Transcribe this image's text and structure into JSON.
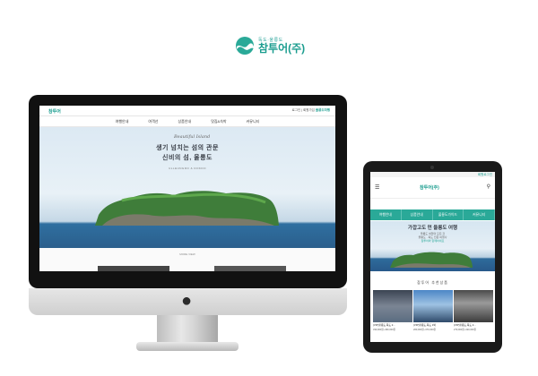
{
  "brand": {
    "sub": "독도·울릉도",
    "name": "참투어(주)"
  },
  "desktop": {
    "logo": "참투어",
    "util_links": "로그인 | 회원가입",
    "util_highlight": "울릉도여행",
    "nav": [
      "여행안내",
      "여객선",
      "상품안내",
      "맛집&숙박",
      "커뮤니티"
    ],
    "script_title": "Beautiful Island",
    "headline_1": "생기 넘치는 섬의 관문",
    "headline_2": "신비의 섬, 울릉도",
    "subline": "ULLEUNGDO & DOKDO",
    "more_label": "MORE VIEW"
  },
  "tablet": {
    "member_link": "회원로그인",
    "menu_icon": "hamburger-icon",
    "logo": "참투어(주)",
    "search_icon": "search-icon",
    "tabs": [
      "여행안내",
      "상품안내",
      "울릉도가이드",
      "커뮤니티"
    ],
    "headline": "가깝고도 먼 울릉도 여행",
    "sub_1": "울릉도 여행의 모든 것",
    "sub_2": "울릉도 · 독도 전문 여행사",
    "sub_3": "참투어와 함께하세요",
    "section_title": "참투어 추천상품",
    "products": [
      {
        "caption": "(VIP)울릉도,독도 2...",
        "price": "330,000원~360,000원"
      },
      {
        "caption": "(VIP)울릉도,독도 1박",
        "price": "260,000원~370,000원"
      },
      {
        "caption": "(VIP)울릉도,독도 2...",
        "price": "270,000원~320,000원"
      }
    ]
  },
  "colors": {
    "brand_teal": "#1b9d8f",
    "tab_teal": "#2aa998",
    "sea_blue": "#2b5f8c"
  }
}
